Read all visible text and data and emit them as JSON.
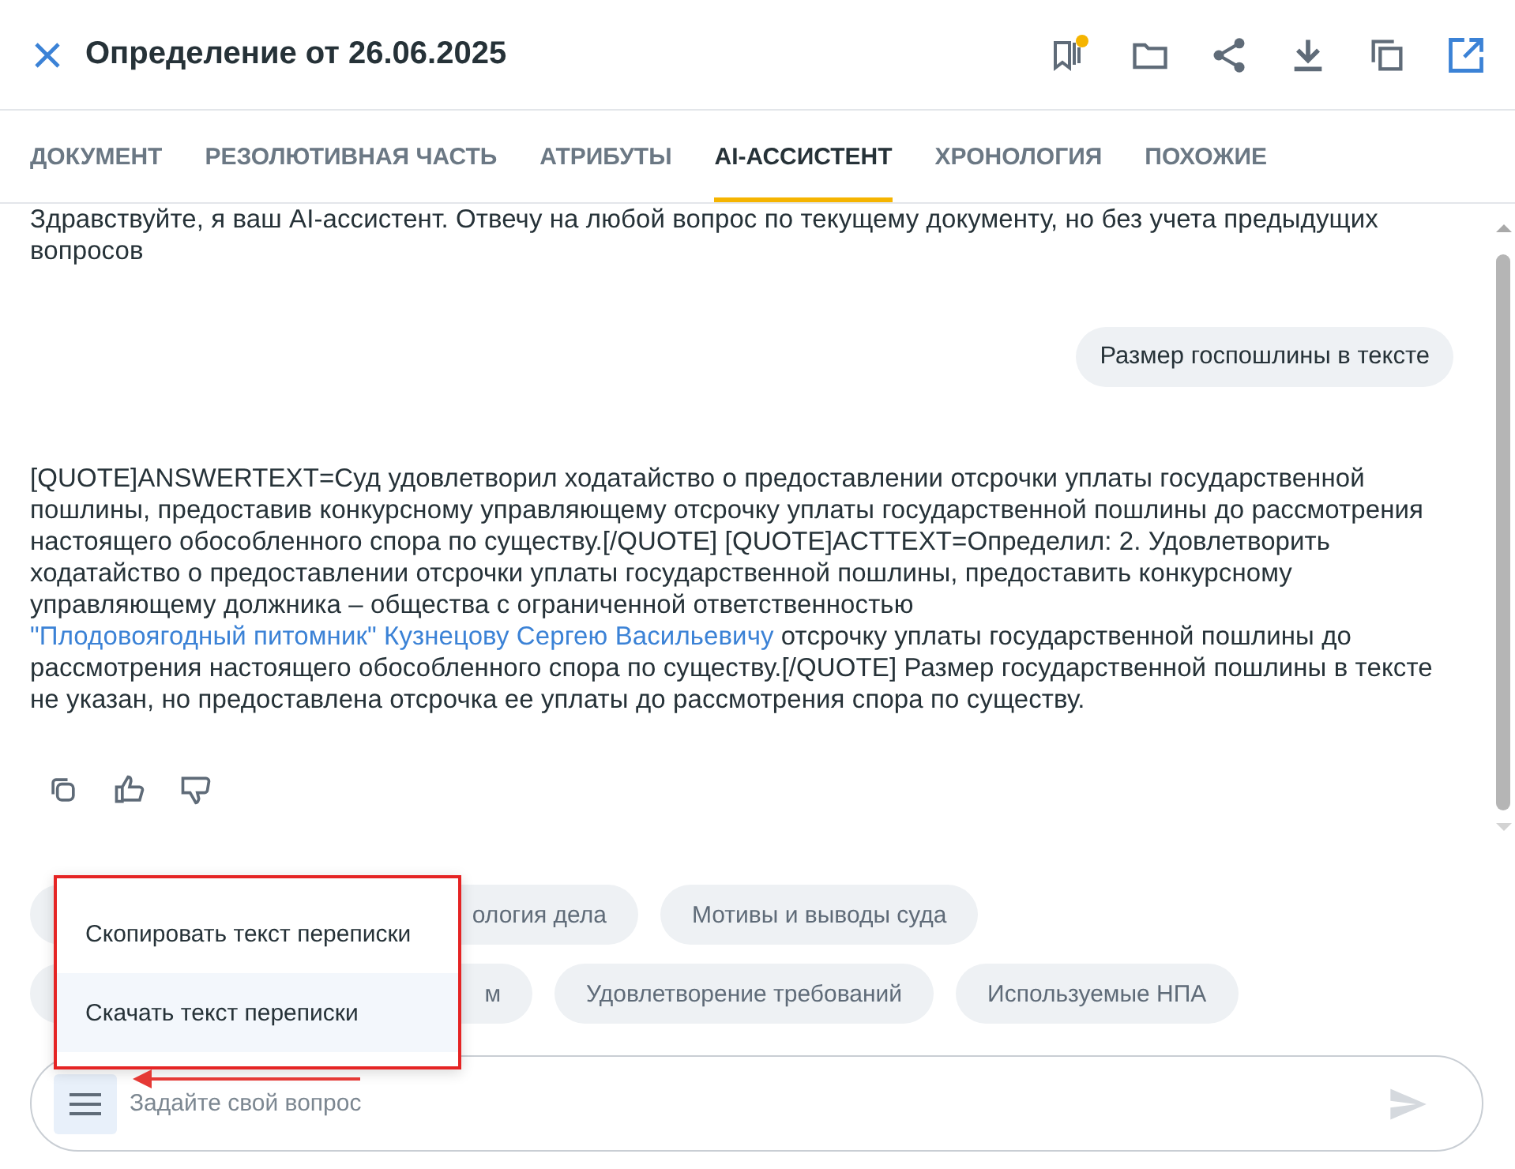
{
  "header": {
    "title": "Определение от 26.06.2025",
    "bookmark_badge": true
  },
  "tabs": [
    {
      "label": "ДОКУМЕНТ",
      "selected": false
    },
    {
      "label": "РЕЗОЛЮТИВНАЯ ЧАСТЬ",
      "selected": false
    },
    {
      "label": "АТРИБУТЫ",
      "selected": false
    },
    {
      "label": "AI-АССИСТЕНТ",
      "selected": true
    },
    {
      "label": "ХРОНОЛОГИЯ",
      "selected": false
    },
    {
      "label": "ПОХОЖИЕ",
      "selected": false
    }
  ],
  "chat": {
    "greeting": "Здравствуйте, я ваш AI-ассистент. Отвечу на любой вопрос по текущему документу, но без учета предыдущих вопросов",
    "question": "Размер госпошлины в тексте",
    "answer": [
      {
        "kind": "text",
        "text": "[QUOTE]ANSWERTEXT=Суд удовлетворил ходатайство о предоставлении отсрочки уплаты государственной пошлины, предоставив конкурсному управляющему отсрочку уплаты государственной пошлины до рассмотрения настоящего обособленного спора по существу.[/QUOTE] [QUOTE]ACTTEXT=Определил: 2. Удовлетворить ходатайство о предоставлении отсрочки уплаты государственной пошлины, предоставить конкурсному управляющему должника – общества с ограниченной ответственностью "
      },
      {
        "kind": "link",
        "text": "\"Плодовоягодный питомник\" Кузнецову Сергею Васильевичу"
      },
      {
        "kind": "text",
        "text": " отсрочку уплаты государственной пошлины до рассмотрения настоящего обособленного спора по существу.[/QUOTE] Размер государственной пошлины в тексте не указан, но предоставлена отсрочка ее уплаты до рассмотрения спора по существу."
      }
    ]
  },
  "suggestions": [
    [
      "ология дела",
      "Мотивы и выводы суда"
    ],
    [
      "м",
      "Удовлетворение требований",
      "Используемые НПА"
    ]
  ],
  "menu": {
    "items": [
      {
        "label": "Скопировать текст переписки",
        "selected": false
      },
      {
        "label": "Скачать текст переписки",
        "selected": true
      }
    ]
  },
  "input": {
    "placeholder": "Задайте свой вопрос"
  }
}
